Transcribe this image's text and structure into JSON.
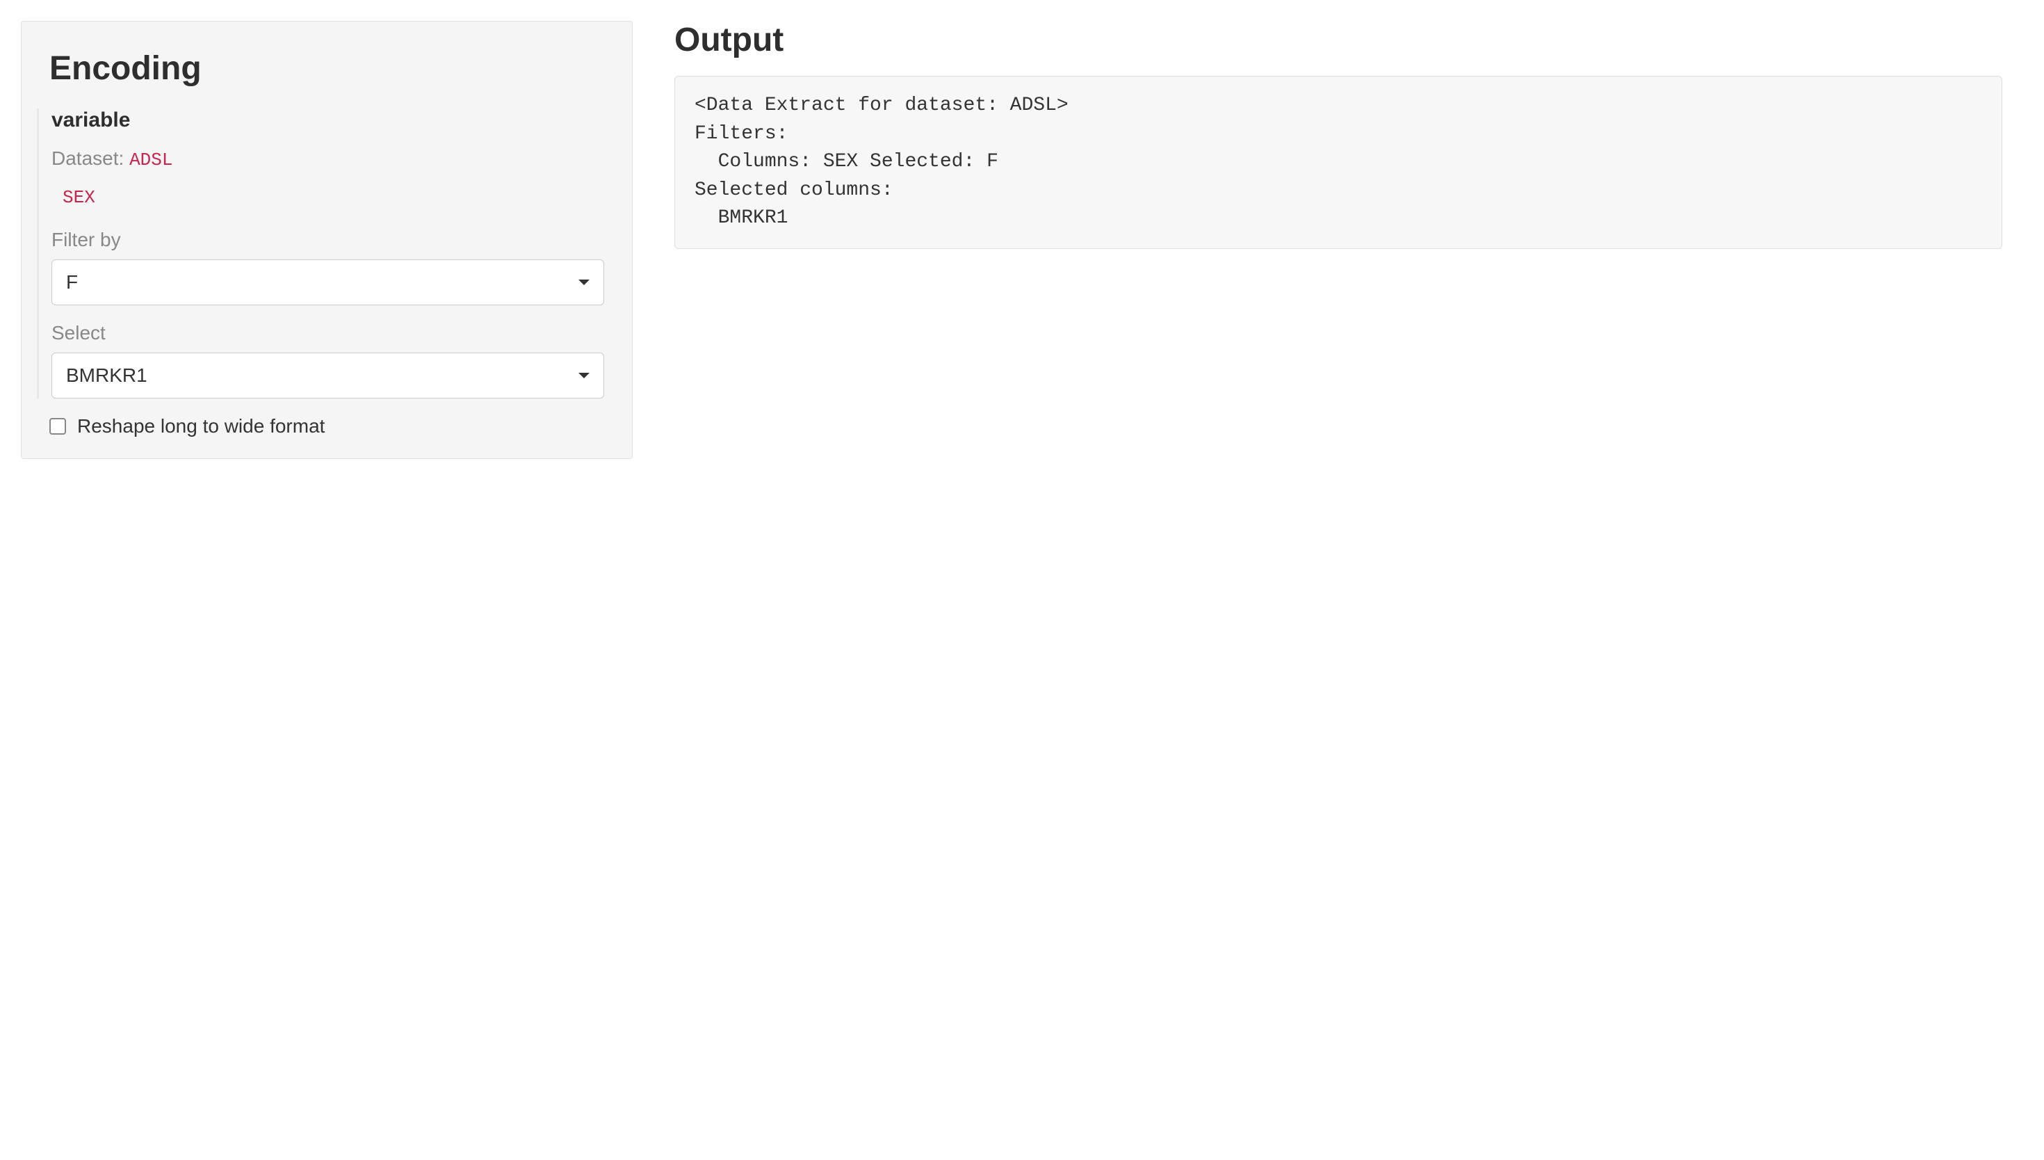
{
  "sidebar": {
    "title": "Encoding",
    "variable_label": "variable",
    "dataset_label": "Dataset:",
    "dataset_value": "ADSL",
    "column_value": "SEX",
    "filter_by_label": "Filter by",
    "filter_by_value": "F",
    "select_label": "Select",
    "select_value": "BMRKR1",
    "reshape_label": "Reshape long to wide format"
  },
  "main": {
    "output_title": "Output",
    "output_text": "<Data Extract for dataset: ADSL>\nFilters:\n  Columns: SEX Selected: F\nSelected columns:\n  BMRKR1"
  }
}
